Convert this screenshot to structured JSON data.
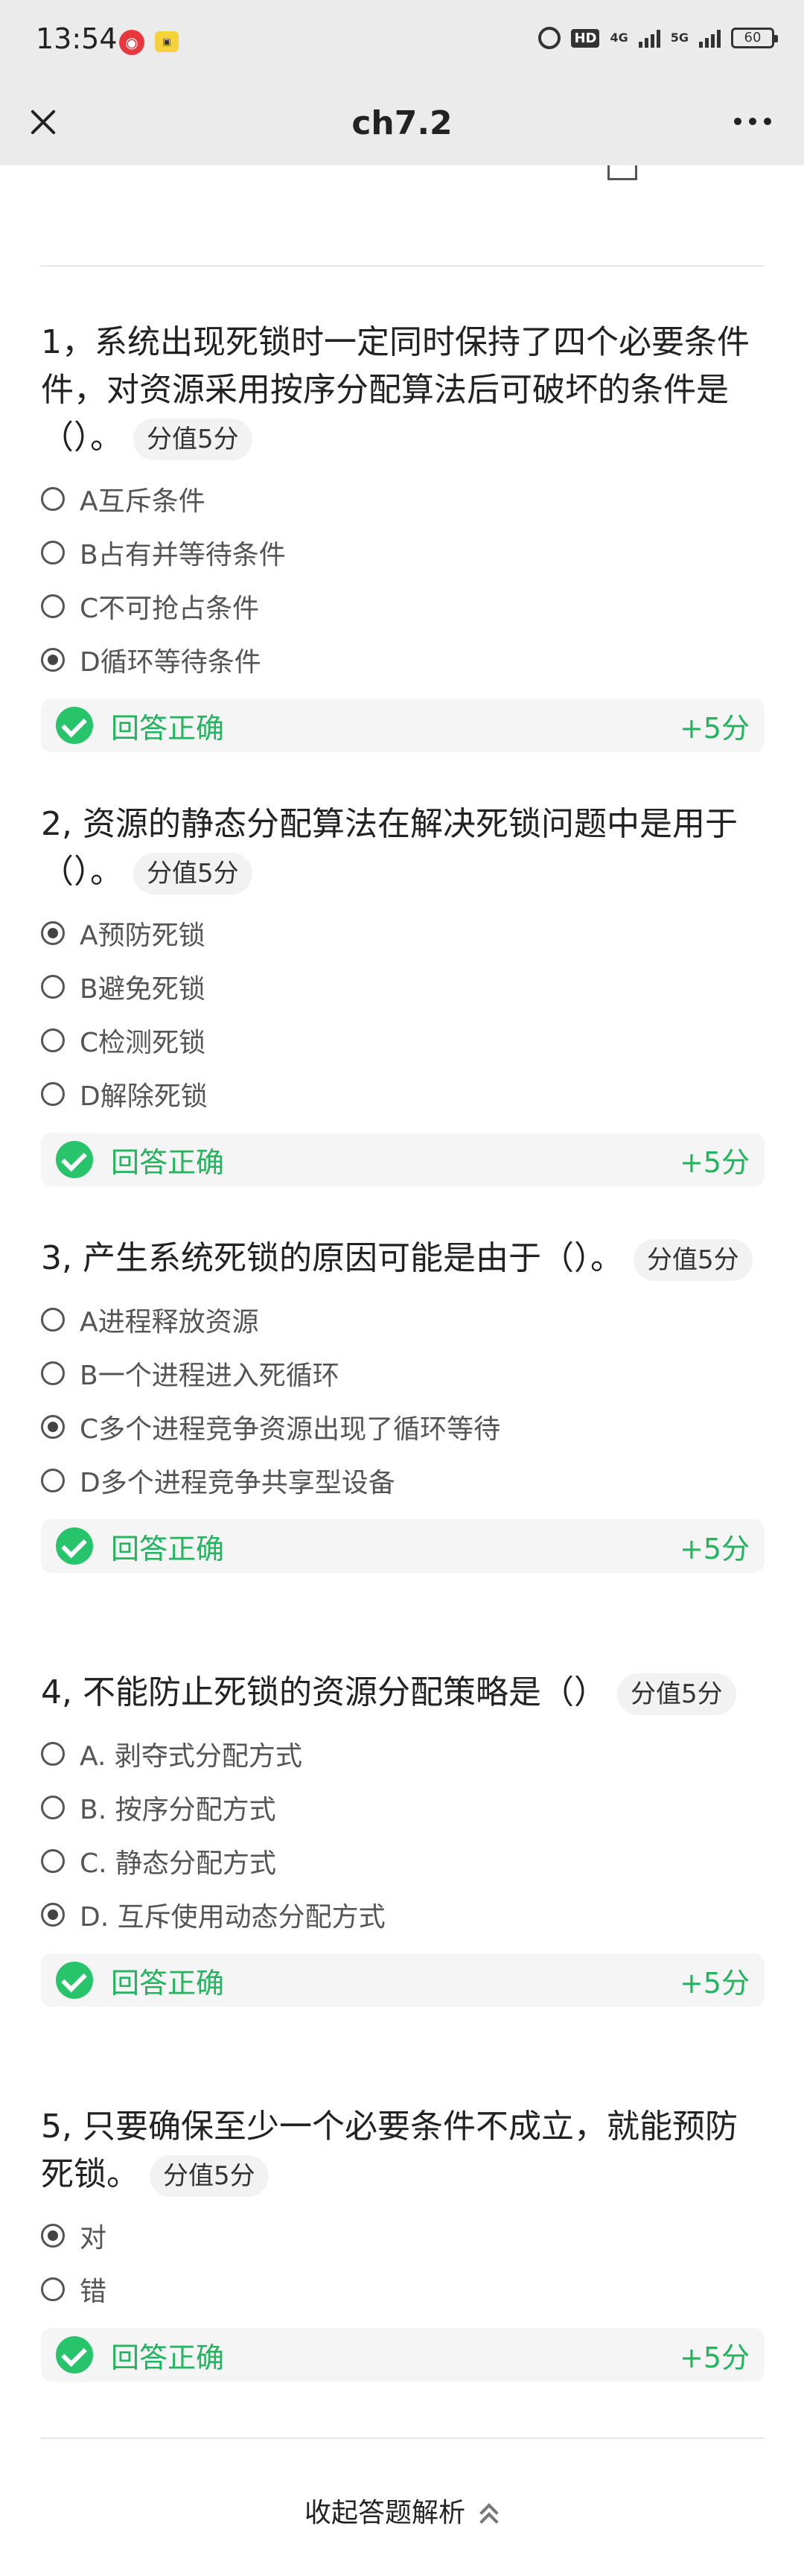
{
  "status_bar": {
    "time": "13:54",
    "network_left": "4G",
    "network_right": "5G",
    "hd_badge": "HD",
    "battery": "60"
  },
  "nav": {
    "title": "ch7.2"
  },
  "questions": [
    {
      "title": "1，系统出现死锁时一定同时保持了四个必要条件件，对资源采用按序分配算法后可破坏的条件是（）。",
      "score": "分值5分",
      "options": [
        {
          "label": "A互斥条件",
          "checked": false
        },
        {
          "label": "B占有并等待条件",
          "checked": false
        },
        {
          "label": "C不可抢占条件",
          "checked": false
        },
        {
          "label": "D循环等待条件",
          "checked": true
        }
      ],
      "result_text": "回答正确",
      "result_score": "+5分"
    },
    {
      "title": "2, 资源的静态分配算法在解决死锁问题中是用于（）。",
      "score": "分值5分",
      "options": [
        {
          "label": "A预防死锁",
          "checked": true
        },
        {
          "label": "B避免死锁",
          "checked": false
        },
        {
          "label": "C检测死锁",
          "checked": false
        },
        {
          "label": "D解除死锁",
          "checked": false
        }
      ],
      "result_text": "回答正确",
      "result_score": "+5分"
    },
    {
      "title": "3, 产生系统死锁的原因可能是由于（）。",
      "score": "分值5分",
      "options": [
        {
          "label": "A进程释放资源",
          "checked": false
        },
        {
          "label": "B一个进程进入死循环",
          "checked": false
        },
        {
          "label": "C多个进程竞争资源出现了循环等待",
          "checked": true
        },
        {
          "label": "D多个进程竞争共享型设备",
          "checked": false
        }
      ],
      "result_text": "回答正确",
      "result_score": "+5分"
    },
    {
      "title": "4, 不能防止死锁的资源分配策略是（）",
      "score": "分值5分",
      "options": [
        {
          "label": "A. 剥夺式分配方式",
          "checked": false
        },
        {
          "label": "B. 按序分配方式",
          "checked": false
        },
        {
          "label": "C. 静态分配方式",
          "checked": false
        },
        {
          "label": "D. 互斥使用动态分配方式",
          "checked": true
        }
      ],
      "result_text": "回答正确",
      "result_score": "+5分"
    },
    {
      "title": "5, 只要确保至少一个必要条件不成立，就能预防死锁。",
      "score": "分值5分",
      "options": [
        {
          "label": "对",
          "checked": true
        },
        {
          "label": "错",
          "checked": false
        }
      ],
      "result_text": "回答正确",
      "result_score": "+5分"
    }
  ],
  "footer": {
    "collapse_label": "收起答题解析"
  }
}
